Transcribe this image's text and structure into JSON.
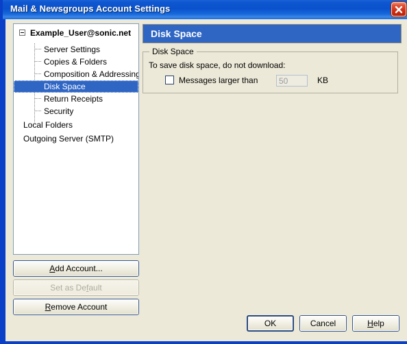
{
  "window": {
    "title": "Mail & Newsgroups Account Settings",
    "close_icon": "close-icon",
    "accent_titlebar": "#0a52cd",
    "accent_selection": "#2f66c4",
    "dialog_background": "#ece9d8"
  },
  "tree": {
    "root": {
      "label": "Example_User@sonic.net",
      "expander_state": "expanded",
      "expander_icon": "minus-box-icon"
    },
    "children": [
      {
        "label": "Server Settings",
        "selected": false
      },
      {
        "label": "Copies & Folders",
        "selected": false
      },
      {
        "label": "Composition & Addressing",
        "selected": false
      },
      {
        "label": "Disk Space",
        "selected": true
      },
      {
        "label": "Return Receipts",
        "selected": false
      },
      {
        "label": "Security",
        "selected": false
      }
    ],
    "top_level": [
      {
        "label": "Local Folders"
      },
      {
        "label": "Outgoing Server (SMTP)"
      }
    ]
  },
  "left_buttons": [
    {
      "name": "add-account-button",
      "label": "Add Account...",
      "accel": "A",
      "enabled": true
    },
    {
      "name": "set-as-default-button",
      "label": "Set as Default",
      "accel": "f",
      "enabled": false
    },
    {
      "name": "remove-account-button",
      "label": "Remove Account",
      "accel": "R",
      "enabled": true
    }
  ],
  "panel": {
    "header_title": "Disk Space",
    "group_legend": "Disk Space",
    "description": "To save disk space, do not download:",
    "checkbox": {
      "label": "Messages larger than",
      "checked": false
    },
    "size_value": "50",
    "size_placeholder": "50",
    "size_enabled": false,
    "unit_label": "KB"
  },
  "dialog_buttons": [
    {
      "name": "ok-button",
      "label": "OK",
      "default": true
    },
    {
      "name": "cancel-button",
      "label": "Cancel",
      "default": false
    },
    {
      "name": "help-button",
      "label": "Help",
      "accel": "H",
      "default": false
    }
  ]
}
